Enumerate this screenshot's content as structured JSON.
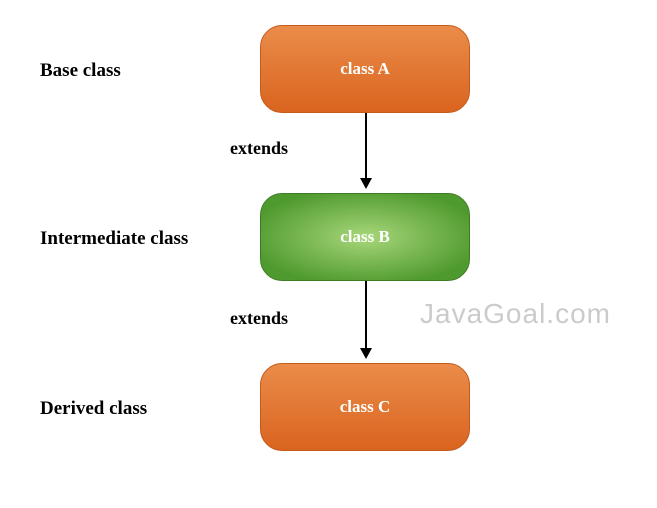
{
  "labels": {
    "base": "Base class",
    "intermediate": "Intermediate class",
    "derived": "Derived class"
  },
  "boxes": {
    "a": "class A",
    "b": "class B",
    "c": "class C"
  },
  "relation": {
    "extends1": "extends",
    "extends2": "extends"
  },
  "watermark": "JavaGoal.com"
}
